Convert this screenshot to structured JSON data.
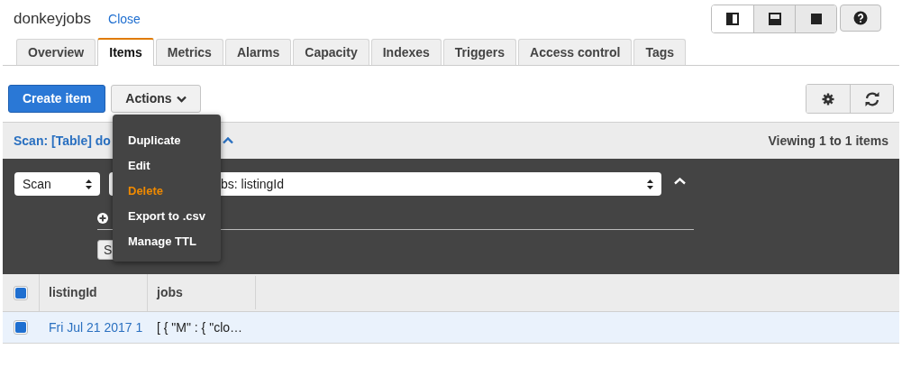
{
  "header": {
    "title": "donkeyjobs",
    "close_link": "Close"
  },
  "view_buttons": [
    {
      "kind": "left",
      "selected": true
    },
    {
      "kind": "bottom",
      "selected": false
    },
    {
      "kind": "full",
      "selected": false
    }
  ],
  "tabs": [
    {
      "label": "Overview",
      "selected": false
    },
    {
      "label": "Items",
      "selected": true
    },
    {
      "label": "Metrics",
      "selected": false
    },
    {
      "label": "Alarms",
      "selected": false
    },
    {
      "label": "Capacity",
      "selected": false
    },
    {
      "label": "Indexes",
      "selected": false
    },
    {
      "label": "Triggers",
      "selected": false
    },
    {
      "label": "Access control",
      "selected": false
    },
    {
      "label": "Tags",
      "selected": false
    }
  ],
  "toolbar": {
    "create_button": "Create item",
    "actions_button": "Actions"
  },
  "actions_menu": [
    {
      "label": "Duplicate",
      "selected": false
    },
    {
      "label": "Edit",
      "selected": false
    },
    {
      "label": "Delete",
      "selected": true
    },
    {
      "label": "Export to .csv",
      "selected": false
    },
    {
      "label": "Manage TTL",
      "selected": false
    }
  ],
  "scan_bar": {
    "title": "Scan: [Table] do",
    "count": "Viewing 1 to 1 items"
  },
  "filter": {
    "mode": "Scan",
    "target": "bs: listingId",
    "start_button": "S"
  },
  "table": {
    "all_checked": true,
    "columns": [
      "listingId",
      "jobs"
    ],
    "rows": [
      {
        "checked": true,
        "selected": true,
        "cells": [
          "Fri Jul 21 2017 1",
          "[ { \"M\" : { \"clo…"
        ]
      }
    ]
  }
}
